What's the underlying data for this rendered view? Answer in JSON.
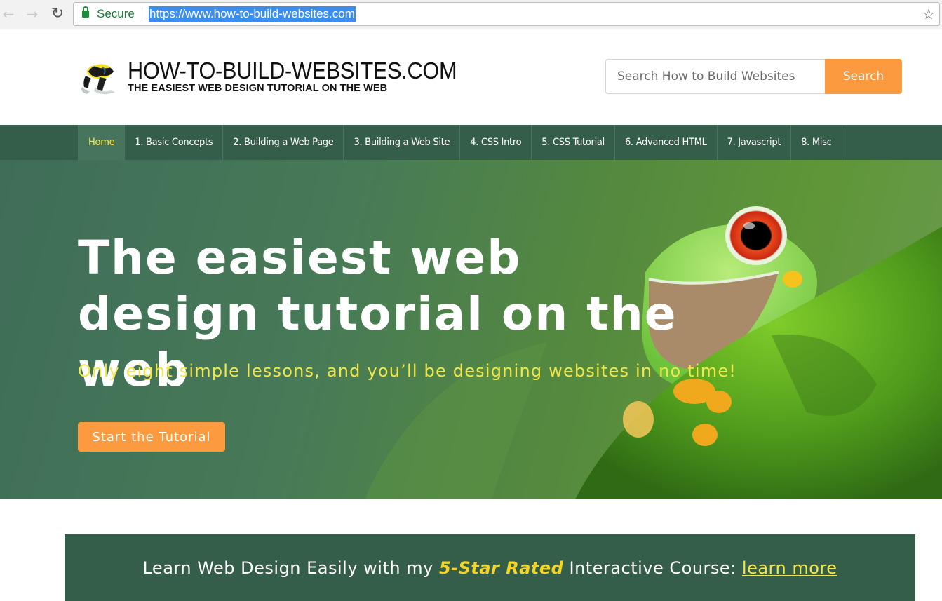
{
  "browser": {
    "back_icon": "arrow-left",
    "forward_icon": "arrow-right",
    "reload_icon": "reload",
    "secure_label": "Secure",
    "url": "https://www.how-to-build-websites.com",
    "bookmark_icon": "star-outline"
  },
  "header": {
    "logo_title": "HOW-TO-BUILD-WEBSITES.COM",
    "logo_subtitle": "THE EASIEST WEB DESIGN TUTORIAL ON THE WEB",
    "search_placeholder": "Search How to Build Websites",
    "search_button": "Search"
  },
  "nav": {
    "items": [
      {
        "label": "Home",
        "active": true
      },
      {
        "label": "1. Basic Concepts"
      },
      {
        "label": "2. Building a Web Page"
      },
      {
        "label": "3. Building a Web Site"
      },
      {
        "label": "4. CSS Intro"
      },
      {
        "label": "5. CSS Tutorial"
      },
      {
        "label": "6. Advanced HTML"
      },
      {
        "label": "7. Javascript"
      },
      {
        "label": "8. Misc"
      }
    ]
  },
  "hero": {
    "title": "The easiest web design tutorial on the web",
    "subtitle": "Only eight simple lessons, and you’ll be designing websites in no time!",
    "cta": "Start the Tutorial"
  },
  "banner": {
    "prefix": "Learn Web Design Easily with my ",
    "emphasis": "5-Star Rated",
    "suffix": " Interactive Course: ",
    "link": "learn more"
  },
  "colors": {
    "nav_bg": "#355e4a",
    "nav_active_bg": "#46745d",
    "nav_active_text": "#f5e84a",
    "accent_orange": "#fc9a3f",
    "hero_subtitle": "#f2e64a",
    "banner_emphasis": "#f5d423"
  }
}
